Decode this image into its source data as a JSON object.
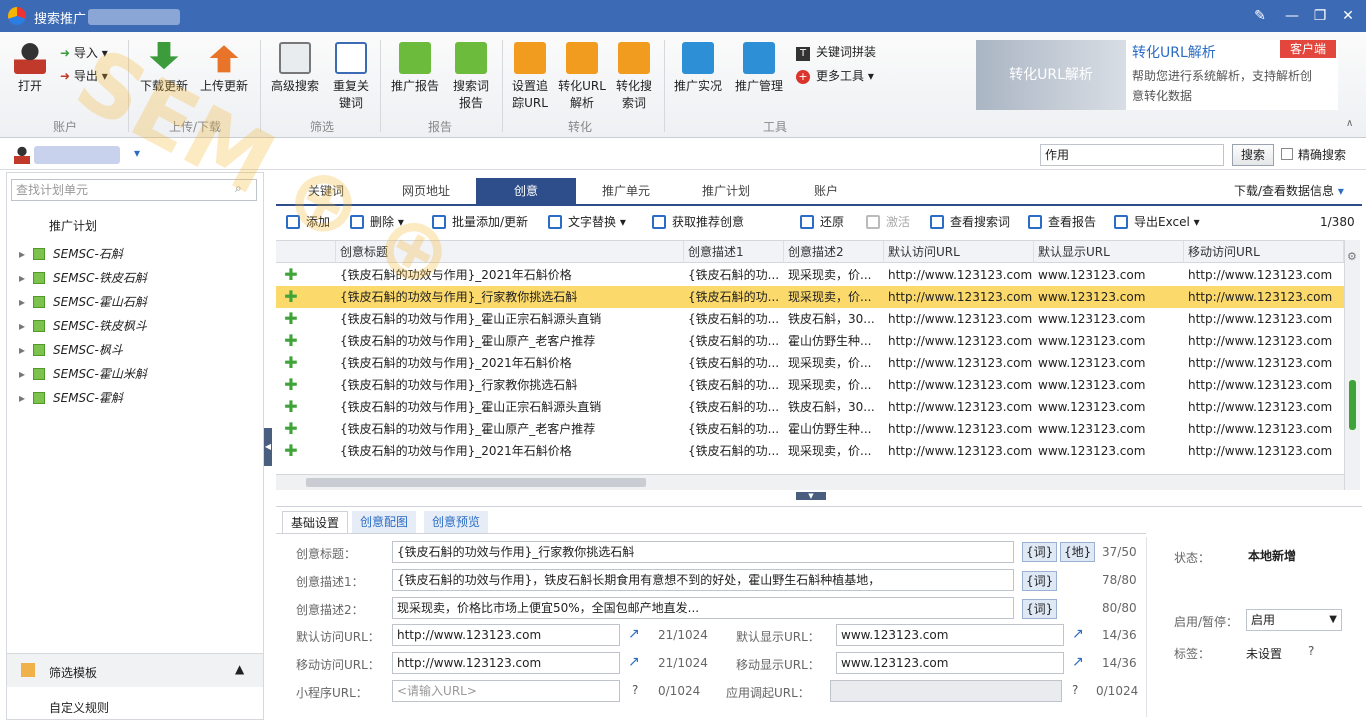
{
  "titlebar": {
    "title": "搜索推广"
  },
  "ribbon": {
    "open": "打开",
    "import": "导入",
    "export": "导出",
    "download_update": "下载更新",
    "upload_update": "上传更新",
    "advanced_search": "高级搜索",
    "recheck_keyword": "重复关键词",
    "promo_report": "推广报告",
    "search_term_report": "搜索词报告",
    "tracking_url": "设置追踪URL",
    "conv_url_parse": "转化URL解析",
    "conv_search_term": "转化搜索词",
    "live_promo": "推广实况",
    "promo_mgmt": "推广管理",
    "keyword_concat": "关键词拼装",
    "more_tools": "更多工具",
    "groups": {
      "account": "账户",
      "updown": "上传/下载",
      "filter": "筛选",
      "report": "报告",
      "convert": "转化",
      "tools": "工具"
    }
  },
  "promo": {
    "image_text": "转化URL解析",
    "title": "转化URL解析",
    "badge": "客户端",
    "desc": "帮助您进行系统解析，支持解析创意转化数据"
  },
  "userbar": {
    "search_value": "作用",
    "search_btn": "搜索",
    "exact_label": "精确搜索"
  },
  "left": {
    "search_placeholder": "查找计划单元",
    "header": "推广计划",
    "plans": [
      "SEMSC-石斛",
      "SEMSC-铁皮石斛",
      "SEMSC-霍山石斛",
      "SEMSC-铁皮枫斗",
      "SEMSC-枫斗",
      "SEMSC-霍山米斛",
      "SEMSC-霍斛"
    ],
    "filter_template": "筛选模板",
    "custom_rule": "自定义规则"
  },
  "tabs": [
    "关键词",
    "网页地址",
    "创意",
    "推广单元",
    "推广计划",
    "账户"
  ],
  "download_view": "下载/查看数据信息",
  "toolbar": {
    "add": "添加",
    "delete": "删除",
    "batch": "批量添加/更新",
    "replace": "文字替换",
    "recommend": "获取推荐创意",
    "restore": "还原",
    "activate": "激活",
    "view_search": "查看搜索词",
    "view_report": "查看报告",
    "export_excel": "导出Excel",
    "pager": "1/380"
  },
  "grid": {
    "columns": [
      "创意标题",
      "创意描述1",
      "创意描述2",
      "默认访问URL",
      "默认显示URL",
      "移动访问URL"
    ],
    "rows": [
      [
        "{铁皮石斛的功效与作用}_2021年石斛价格",
        "{铁皮石斛的功...",
        "现采现卖，价...",
        "http://www.123123.com",
        "www.123123.com",
        "http://www.123123.com"
      ],
      [
        "{铁皮石斛的功效与作用}_行家教你挑选石斛",
        "{铁皮石斛的功...",
        "现采现卖，价...",
        "http://www.123123.com",
        "www.123123.com",
        "http://www.123123.com"
      ],
      [
        "{铁皮石斛的功效与作用}_霍山正宗石斛源头直销",
        "{铁皮石斛的功...",
        "铁皮石斛，30...",
        "http://www.123123.com",
        "www.123123.com",
        "http://www.123123.com"
      ],
      [
        "{铁皮石斛的功效与作用}_霍山原产_老客户推荐",
        "{铁皮石斛的功...",
        "霍山仿野生种...",
        "http://www.123123.com",
        "www.123123.com",
        "http://www.123123.com"
      ],
      [
        "{铁皮石斛的功效与作用}_2021年石斛价格",
        "{铁皮石斛的功...",
        "现采现卖，价...",
        "http://www.123123.com",
        "www.123123.com",
        "http://www.123123.com"
      ],
      [
        "{铁皮石斛的功效与作用}_行家教你挑选石斛",
        "{铁皮石斛的功...",
        "现采现卖，价...",
        "http://www.123123.com",
        "www.123123.com",
        "http://www.123123.com"
      ],
      [
        "{铁皮石斛的功效与作用}_霍山正宗石斛源头直销",
        "{铁皮石斛的功...",
        "铁皮石斛，30...",
        "http://www.123123.com",
        "www.123123.com",
        "http://www.123123.com"
      ],
      [
        "{铁皮石斛的功效与作用}_霍山原产_老客户推荐",
        "{铁皮石斛的功...",
        "霍山仿野生种...",
        "http://www.123123.com",
        "www.123123.com",
        "http://www.123123.com"
      ],
      [
        "{铁皮石斛的功效与作用}_2021年石斛价格",
        "{铁皮石斛的功...",
        "现采现卖，价...",
        "http://www.123123.com",
        "www.123123.com",
        "http://www.123123.com"
      ]
    ]
  },
  "detail": {
    "tabs": [
      "基础设置",
      "创意配图",
      "创意预览"
    ],
    "title_label": "创意标题：",
    "title_value": "{铁皮石斛的功效与作用}_行家教你挑选石斛",
    "title_count": "37/50",
    "desc1_label": "创意描述1：",
    "desc1_value": "{铁皮石斛的功效与作用}，铁皮石斛长期食用有意想不到的好处，霍山野生石斛种植基地，",
    "desc1_count": "78/80",
    "desc2_label": "创意描述2：",
    "desc2_value": "现采现卖，价格比市场上便宜50%，全国包邮产地直发...",
    "desc2_count": "80/80",
    "tag_ci": "{词}",
    "tag_di": "{地}",
    "def_url_label": "默认访问URL：",
    "def_url": "http://www.123123.com",
    "def_url_count": "21/1024",
    "def_show_label": "默认显示URL：",
    "def_show": "www.123123.com",
    "def_show_count": "14/36",
    "mob_url_label": "移动访问URL：",
    "mob_url": "http://www.123123.com",
    "mob_url_count": "21/1024",
    "mob_show_label": "移动显示URL：",
    "mob_show": "www.123123.com",
    "mob_show_count": "14/36",
    "mini_label": "小程序URL：",
    "mini_placeholder": "<请输入URL>",
    "mini_count": "0/1024",
    "app_label": "应用调起URL：",
    "app_count": "0/1024",
    "status_label": "状态：",
    "status_value": "本地新增",
    "enable_label": "启用/暂停：",
    "enable_value": "启用",
    "tag_label": "标签：",
    "tag_value": "未设置"
  },
  "colors": {
    "titlebar": "#3c6ab5",
    "selected_row": "#fbd96b",
    "active_tab": "#2d4e8a"
  }
}
